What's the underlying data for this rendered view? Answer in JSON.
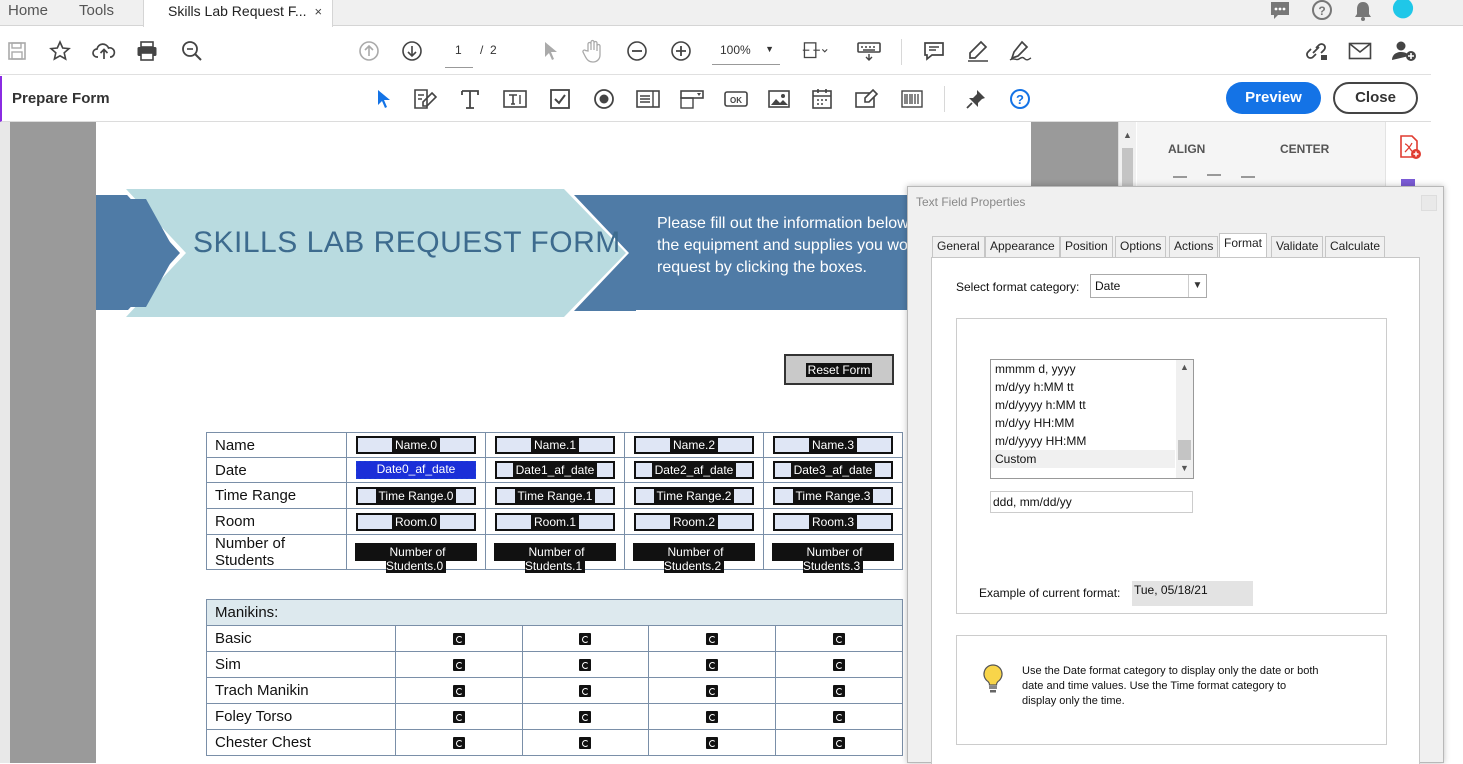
{
  "tabs": {
    "home": "Home",
    "tools": "Tools",
    "document": "Skills Lab Request F...",
    "close": "×"
  },
  "toolbar": {
    "page_current": "1",
    "page_sep": "/",
    "page_total": "2",
    "zoom": "100%"
  },
  "prepare": {
    "title": "Prepare Form",
    "preview": "Preview",
    "close": "Close"
  },
  "document": {
    "form_title": "SKILLS LAB REQUEST FORM",
    "banner_lines": [
      "Please fill out the information below",
      "the equipment and supplies you wo",
      "request by clicking the boxes."
    ],
    "reset_button": "Reset Form",
    "info_rows": [
      {
        "label": "Name",
        "fields": [
          "Name.0",
          "Name.1",
          "Name.2",
          "Name.3"
        ]
      },
      {
        "label": "Date",
        "fields": [
          "Date0_af_date",
          "Date1_af_date",
          "Date2_af_date",
          "Date3_af_date"
        ]
      },
      {
        "label": "Time Range",
        "fields": [
          "Time Range.0",
          "Time Range.1",
          "Time Range.2",
          "Time Range.3"
        ]
      },
      {
        "label": "Room",
        "fields": [
          "Room.0",
          "Room.1",
          "Room.2",
          "Room.3"
        ]
      },
      {
        "label": "Number of Students",
        "fields": [
          "Number of Students.0",
          "Number of Students.1",
          "Number of Students.2",
          "Number of Students.3"
        ]
      }
    ],
    "manikins_header": "Manikins:",
    "manikin_rows": [
      "Basic",
      "Sim",
      "Trach Manikin",
      "Foley Torso",
      "Chester Chest"
    ]
  },
  "right_panel": {
    "align": "ALIGN",
    "center": "CENTER"
  },
  "dialog": {
    "title": "Text Field Properties",
    "tabs": [
      "General",
      "Appearance",
      "Position",
      "Options",
      "Actions",
      "Format",
      "Validate",
      "Calculate"
    ],
    "active_tab": "Format",
    "category_label": "Select format category:",
    "category_value": "Date",
    "format_list": [
      "mmmm d, yyyy",
      "m/d/yy h:MM tt",
      "m/d/yyyy h:MM tt",
      "m/d/yy HH:MM",
      "m/d/yyyy HH:MM",
      "Custom"
    ],
    "selected_format": "Custom",
    "custom_value": "ddd, mm/dd/yy",
    "example_label": "Example of current format:",
    "example_value": "Tue, 05/18/21",
    "hint": "Use the Date format category to display only the date or both date and time values. Use the Time format category to display only the time."
  },
  "colors": {
    "accent": "#1473e6",
    "banner": "#4f7ba6",
    "chevron": "#b9dbe0",
    "title": "#3d6b8e"
  }
}
